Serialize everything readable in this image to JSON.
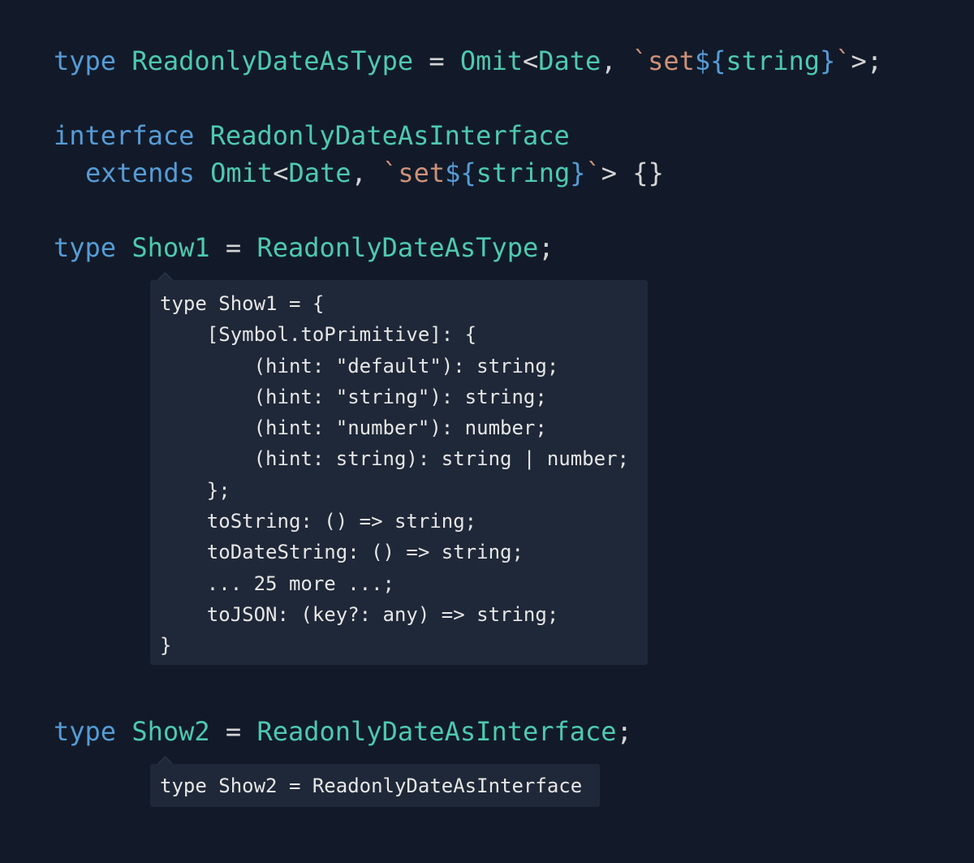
{
  "editor": {
    "line1": {
      "kw": "type",
      "name": "ReadonlyDateAsType",
      "eq": " = ",
      "omit": "Omit",
      "lt": "<",
      "date": "Date",
      "comma": ", ",
      "tick1": "`",
      "set": "set",
      "dollar": "${",
      "string": "string",
      "brace": "}",
      "tick2": "`",
      "end": ">;"
    },
    "line2": {
      "kw": "interface",
      "name": "ReadonlyDateAsInterface"
    },
    "line3": {
      "kw": "extends",
      "omit": "Omit",
      "lt": "<",
      "date": "Date",
      "comma": ", ",
      "tick1": "`",
      "set": "set",
      "dollar": "${",
      "string": "string",
      "brace": "}",
      "tick2": "`",
      "end": "> {}"
    },
    "line4": {
      "kw": "type",
      "name": "Show1",
      "eq": " = ",
      "ref": "ReadonlyDateAsType",
      "semi": ";"
    },
    "line5": {
      "kw": "type",
      "name": "Show2",
      "eq": " = ",
      "ref": "ReadonlyDateAsInterface",
      "semi": ";"
    }
  },
  "tooltip1": {
    "lines": [
      "type Show1 = {",
      "    [Symbol.toPrimitive]: {",
      "        (hint: \"default\"): string;",
      "        (hint: \"string\"): string;",
      "        (hint: \"number\"): number;",
      "        (hint: string): string | number;",
      "    };",
      "    toString: () => string;",
      "    toDateString: () => string;",
      "    ... 25 more ...;",
      "    toJSON: (key?: any) => string;",
      "}"
    ]
  },
  "tooltip2": {
    "lines": [
      "type Show2 = ReadonlyDateAsInterface"
    ]
  },
  "colors": {
    "background": "#121a29",
    "keyword": "#569cd6",
    "type": "#4ec9b0",
    "string": "#ce9178",
    "tooltip_bg": "#1f2838"
  }
}
